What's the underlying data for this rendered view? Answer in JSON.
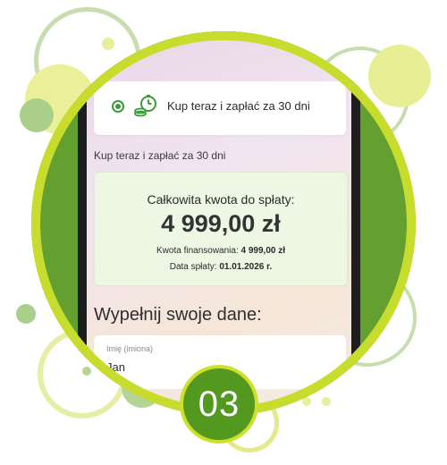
{
  "payment_option": {
    "label": "Kup teraz i zapłać za 30 dni",
    "icon": "clock-coins-icon",
    "selected": true
  },
  "selected_summary": "Kup teraz i zapłać za 30 dni",
  "summary": {
    "title": "Całkowita kwota do spłaty:",
    "amount": "4 999,00 zł",
    "financing_label": "Kwota finansowania:",
    "financing_value": "4 999,00 zł",
    "due_label": "Data spłaty:",
    "due_value": "01.01.2026 r."
  },
  "form": {
    "heading": "Wypełnij swoje dane:",
    "first_name_label": "Imię (imiona)",
    "first_name_value": "Jan"
  },
  "step_badge": "03",
  "colors": {
    "accent_green": "#53981f",
    "lime": "#cfe02a",
    "summary_bg": "#eef6e4"
  }
}
